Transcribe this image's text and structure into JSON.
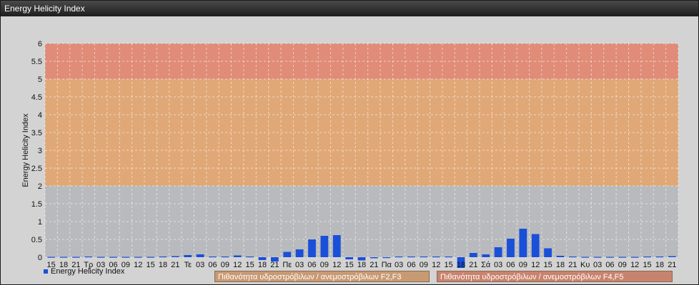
{
  "window": {
    "title": "Energy Helicity Index"
  },
  "legend": {
    "series_label": "Energy Helicity Index"
  },
  "zones": {
    "f2f3": "Πιθανότητα υδροστρόβιλων / ανεμοστρόβιλων F2,F3",
    "f4f5": "Πιθανότητα υδροστρόβιλων / ανεμοστρόβιλων F4,F5"
  },
  "colors": {
    "bar": "#1a4fd8",
    "band_low": "#b8babd",
    "band_mid": "#e0a877",
    "band_high": "#e08c78"
  },
  "chart_data": {
    "type": "bar",
    "ylabel": "Energy Helicity Index",
    "xlabel": "",
    "ylim": [
      0,
      6
    ],
    "yticks": [
      "0",
      "0.5",
      "1",
      "1.5",
      "2",
      "2.5",
      "3",
      "3.5",
      "4",
      "4.5",
      "5",
      "5.5",
      "6"
    ],
    "grid": true,
    "legend_position": "bottom-left",
    "bands": [
      {
        "from": 0,
        "to": 2,
        "color": "#b8babd"
      },
      {
        "from": 2,
        "to": 5,
        "color": "#e0a877"
      },
      {
        "from": 5,
        "to": 6,
        "color": "#e08c78"
      }
    ],
    "categories": [
      "15",
      "18",
      "21",
      "Τρ",
      "03",
      "06",
      "09",
      "12",
      "15",
      "18",
      "21",
      "Τε",
      "03",
      "06",
      "09",
      "12",
      "15",
      "18",
      "21",
      "Πε",
      "03",
      "06",
      "09",
      "12",
      "15",
      "18",
      "21",
      "Πα",
      "03",
      "06",
      "09",
      "12",
      "15",
      "18",
      "21",
      "Σά",
      "03",
      "06",
      "09",
      "12",
      "15",
      "18",
      "21",
      "Κυ",
      "03",
      "06",
      "09",
      "12",
      "15",
      "18",
      "21"
    ],
    "series": [
      {
        "name": "Energy Helicity Index",
        "values": [
          0.01,
          0.01,
          0.01,
          0.02,
          0.01,
          0.01,
          0.01,
          0.01,
          0.01,
          0.02,
          0.03,
          0.06,
          0.08,
          0.02,
          0.02,
          0.05,
          0.02,
          -0.08,
          -0.12,
          0.15,
          0.22,
          0.5,
          0.6,
          0.62,
          -0.06,
          -0.09,
          -0.03,
          -0.02,
          0.02,
          0.02,
          0.02,
          0.02,
          0.02,
          -0.3,
          0.12,
          0.08,
          0.28,
          0.52,
          0.8,
          0.65,
          0.25,
          0.04,
          0.02,
          0.01,
          0.01,
          0.01,
          0.01,
          0.01,
          0.02,
          0.02,
          0.03
        ]
      }
    ]
  }
}
